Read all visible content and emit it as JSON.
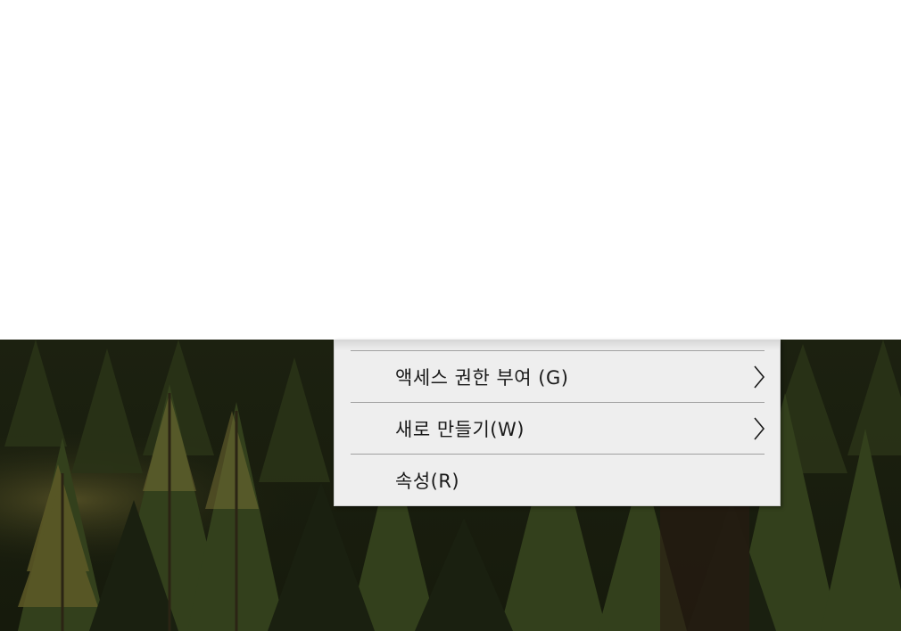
{
  "context_menu": {
    "items": [
      {
        "label": "액세스 권한 부여 (G)",
        "has_submenu": true,
        "icon": "chevron-right-icon"
      },
      {
        "label": "새로 만들기(W)",
        "has_submenu": true,
        "icon": "chevron-right-icon"
      },
      {
        "label": "속성(R)",
        "has_submenu": false
      }
    ]
  },
  "colors": {
    "menu_background": "#eeeeee",
    "separator": "#a0a0a0",
    "text": "#1a1a1a",
    "wallpaper_dark": "#1f2312",
    "wallpaper_tree": "#3a4520"
  },
  "wallpaper": {
    "subject": "forest-of-conifer-trees"
  }
}
